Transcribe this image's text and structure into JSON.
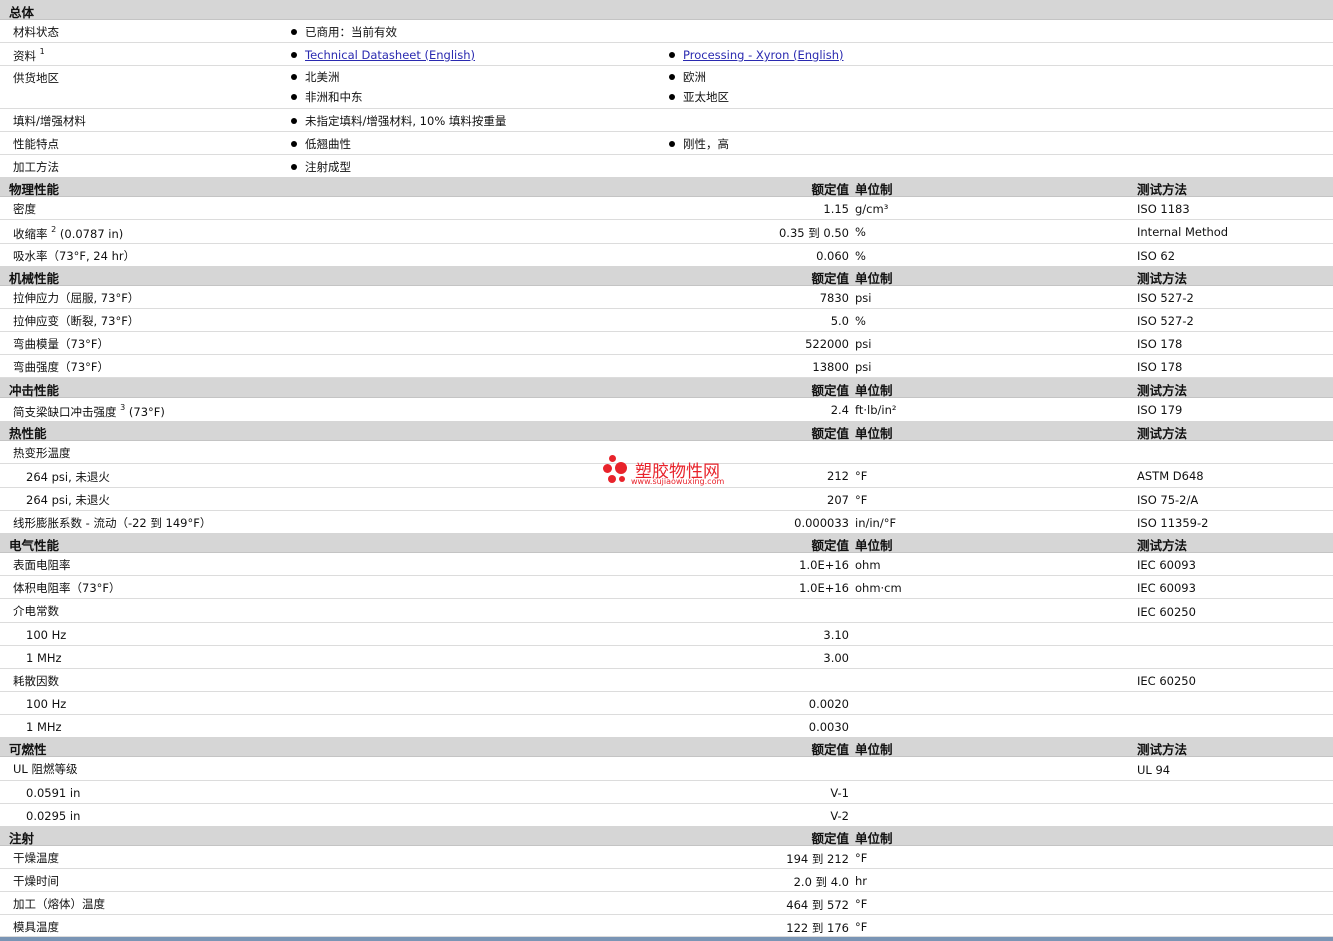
{
  "general": {
    "title": "总体",
    "status_label": "材料状态",
    "status_value": "已商用：当前有效",
    "docs_label": "资料",
    "docs_sup": "1",
    "doc1": "Technical Datasheet (English)",
    "doc2": "Processing - Xyron (English)",
    "regions_label": "供货地区",
    "region1": "北美洲",
    "region2": "欧洲",
    "region3": "非洲和中东",
    "region4": "亚太地区",
    "filler_label": "填料/增强材料",
    "filler_value": "未指定填料/增强材料, 10% 填料按重量",
    "features_label": "性能特点",
    "feature1": "低翘曲性",
    "feature2": "刚性，高",
    "process_label": "加工方法",
    "process_value": "注射成型"
  },
  "columns": {
    "value": "额定值",
    "unit": "单位制",
    "method": "测试方法"
  },
  "physical": {
    "title": "物理性能",
    "density": {
      "label": "密度",
      "value": "1.15",
      "unit": "g/cm³",
      "method": "ISO 1183"
    },
    "shrink": {
      "label": "收缩率",
      "sup": "2",
      "cond": "(0.0787 in)",
      "value": "0.35 到  0.50",
      "unit": "%",
      "method": "Internal Method"
    },
    "water": {
      "label": "吸水率（73°F, 24 hr）",
      "value": "0.060",
      "unit": "%",
      "method": "ISO 62"
    }
  },
  "mechanical": {
    "title": "机械性能",
    "r1": {
      "label": "拉伸应力（屈服, 73°F）",
      "value": "7830",
      "unit": "psi",
      "method": "ISO 527-2"
    },
    "r2": {
      "label": "拉伸应变（断裂, 73°F）",
      "value": "5.0",
      "unit": "%",
      "method": "ISO 527-2"
    },
    "r3": {
      "label": "弯曲模量（73°F）",
      "value": "522000",
      "unit": "psi",
      "method": "ISO 178"
    },
    "r4": {
      "label": "弯曲强度（73°F）",
      "value": "13800",
      "unit": "psi",
      "method": "ISO 178"
    }
  },
  "impact": {
    "title": "冲击性能",
    "r1": {
      "label": "简支梁缺口冲击强度",
      "sup": "3",
      "cond": "(73°F)",
      "value": "2.4",
      "unit": "ft·lb/in²",
      "method": "ISO 179"
    }
  },
  "thermal": {
    "title": "热性能",
    "hdt_label": "热变形温度",
    "r1": {
      "label": "264 psi, 未退火",
      "value": "212",
      "unit": "°F",
      "method": "ASTM D648"
    },
    "r2": {
      "label": "264 psi, 未退火",
      "value": "207",
      "unit": "°F",
      "method": "ISO 75-2/A"
    },
    "r3": {
      "label": "线形膨胀系数 - 流动（-22 到  149°F）",
      "value": "0.000033",
      "unit": "in/in/°F",
      "method": "ISO 11359-2"
    }
  },
  "electrical": {
    "title": "电气性能",
    "r1": {
      "label": "表面电阻率",
      "value": "1.0E+16",
      "unit": "ohm",
      "method": "IEC 60093"
    },
    "r2": {
      "label": "体积电阻率（73°F）",
      "value": "1.0E+16",
      "unit": "ohm·cm",
      "method": "IEC 60093"
    },
    "diel_label": "介电常数",
    "diel_method": "IEC 60250",
    "d1": {
      "label": "100 Hz",
      "value": "3.10"
    },
    "d2": {
      "label": "1 MHz",
      "value": "3.00"
    },
    "loss_label": "耗散因数",
    "loss_method": "IEC 60250",
    "l1": {
      "label": "100 Hz",
      "value": "0.0020"
    },
    "l2": {
      "label": "1 MHz",
      "value": "0.0030"
    }
  },
  "flammability": {
    "title": "可燃性",
    "ul_label": "UL 阻燃等级",
    "ul_method": "UL 94",
    "f1": {
      "label": "0.0591 in",
      "value": "V-1"
    },
    "f2": {
      "label": "0.0295 in",
      "value": "V-2"
    }
  },
  "injection": {
    "title": "注射",
    "r1": {
      "label": "干燥温度",
      "value": "194 到  212",
      "unit": "°F"
    },
    "r2": {
      "label": "干燥时间",
      "value": "2.0 到  4.0",
      "unit": "hr"
    },
    "r3": {
      "label": "加工（熔体）温度",
      "value": "464 到  572",
      "unit": "°F"
    },
    "r4": {
      "label": "模具温度",
      "value": "122 到  176",
      "unit": "°F"
    }
  },
  "watermark": {
    "title": "塑胶物性网",
    "url": "www.sujiaowuxing.com"
  }
}
